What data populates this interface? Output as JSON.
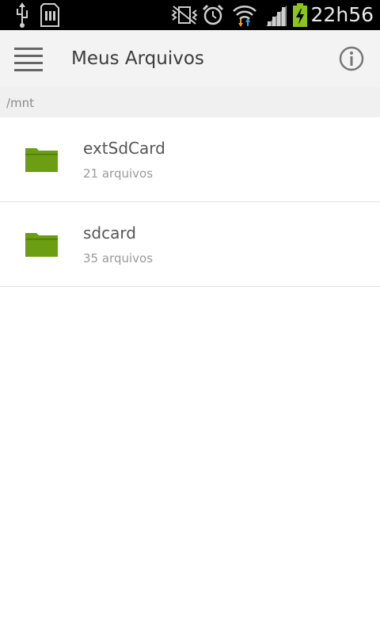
{
  "status_bar": {
    "time": "22h56",
    "icons": [
      "usb-icon",
      "sd-card-icon",
      "no-vibrate-icon",
      "alarm-clock-icon",
      "wifi-icon",
      "signal-icon",
      "battery-charging-icon"
    ]
  },
  "action_bar": {
    "title": "Meus Arquivos",
    "menu_icon": "hamburger-menu-icon",
    "info_icon": "info-icon"
  },
  "path": "/mnt",
  "folders": [
    {
      "name": "extSdCard",
      "count": "21 arquivos",
      "icon": "folder-icon"
    },
    {
      "name": "sdcard",
      "count": "35 arquivos",
      "icon": "folder-icon"
    }
  ],
  "colors": {
    "folder": "#6b9e12",
    "status_bar": "#000000",
    "action_bar": "#f3f3f3",
    "battery": "#8bc31f",
    "wifi_up_arrow": "#2ba9e0",
    "wifi_down_arrow": "#f39c12"
  }
}
